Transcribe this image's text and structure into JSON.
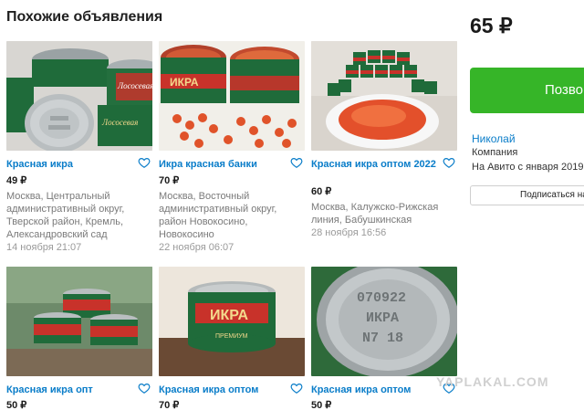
{
  "section": {
    "title": "Похожие объявления"
  },
  "listings": [
    {
      "title": "Красная икра",
      "price": "49 ₽",
      "address": "Москва, Центральный административный округ, Тверской район, Кремль, Александровский сад",
      "date": "14 ноября 21:07"
    },
    {
      "title": "Икра красная банки",
      "price": "70 ₽",
      "address": "Москва, Восточный административный округ, район Новокосино, Новокосино",
      "date": "22 ноября 06:07"
    },
    {
      "title": "Красная икра оптом 2022",
      "price": "60 ₽",
      "address": "Москва, Калужско-Рижская линия, Бабушкинская",
      "date": "28 ноября 16:56"
    },
    {
      "title": "Красная икра опт",
      "price": "50 ₽"
    },
    {
      "title": "Красная икра оптом",
      "price": "70 ₽"
    },
    {
      "title": "Красная икра оптом",
      "price": "50 ₽"
    }
  ],
  "sidebar": {
    "price": "65 ₽",
    "cta_label": "Позво",
    "seller_name": "Николай",
    "seller_type": "Компания",
    "seller_since": "На Авито с января 2019",
    "subscribe_label": "Подписаться на"
  },
  "thumb_labels": {
    "can1": "Лососевая",
    "can2": "ИКРА",
    "can3": "Лососевая",
    "lid1": "070922",
    "lid2": "ИКРА",
    "lid3": "N7 18",
    "can4": "ИКРА",
    "can5": "ПРЕМИУМ"
  },
  "watermark": "YAPLAKAL.COM",
  "colors": {
    "link": "#0a7dc9",
    "cta": "#36b528",
    "can_green": "#1f6b3a",
    "can_red": "#c8322a",
    "caviar": "#e0532a"
  }
}
